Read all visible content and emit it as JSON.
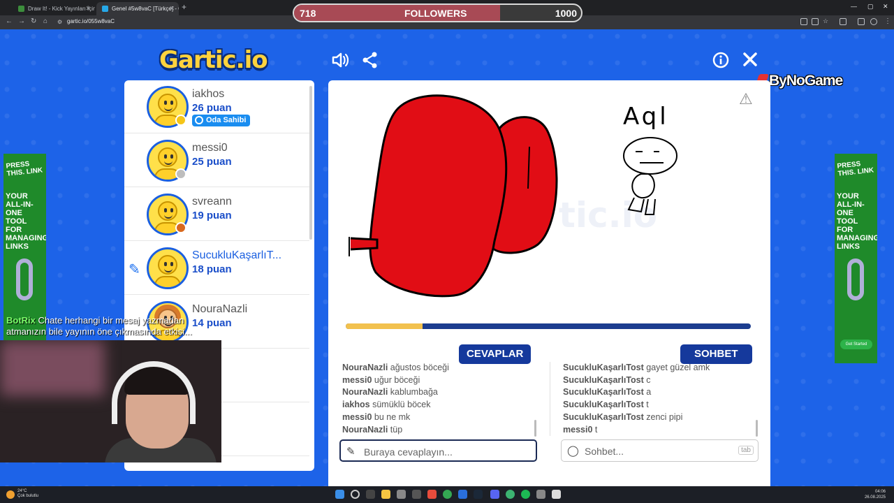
{
  "browser": {
    "tabs": [
      {
        "title": "Draw It! - Kick Yayınları İçin Çizi...",
        "favicon": "#3c8d3c"
      },
      {
        "title": "Genel #5w8vaC [Türkçe] - Gartic.io",
        "favicon": "#26a8e8"
      }
    ],
    "url": "gartic.io/055w8vaC"
  },
  "followers": {
    "current": "718",
    "label": "FOLLOWERS",
    "goal": "1000",
    "progress": 0.718
  },
  "brand": {
    "logo": "Gartic.io",
    "sponsor": "ByNoGame"
  },
  "players": [
    {
      "name": "iakhos",
      "points": "26 puan",
      "badge": "Oda Sahibi",
      "status_color": "#f5c518",
      "drawing": false
    },
    {
      "name": "messi0",
      "points": "25 puan",
      "badge": "",
      "status_color": "#bdbdbd",
      "drawing": false
    },
    {
      "name": "svreann",
      "points": "19 puan",
      "badge": "",
      "status_color": "#d9691e",
      "drawing": false
    },
    {
      "name": "SucukluKaşarlıT...",
      "points": "18 puan",
      "badge": "",
      "status_color": "",
      "drawing": true
    },
    {
      "name": "NouraNazli",
      "points": "14 puan",
      "badge": "",
      "status_color": "",
      "drawing": false
    }
  ],
  "canvas": {
    "scribble_text": "Aql",
    "timer_progress": 0.19
  },
  "answers": {
    "title": "CEVAPLAR",
    "messages": [
      {
        "user": "NouraNazli",
        "text": "ağustos böceği"
      },
      {
        "user": "messi0",
        "text": "uğur böceği"
      },
      {
        "user": "NouraNazli",
        "text": "kablumbağa"
      },
      {
        "user": "iakhos",
        "text": "sümüklü böcek"
      },
      {
        "user": "messi0",
        "text": "bu ne mk"
      },
      {
        "user": "NouraNazli",
        "text": "tüp"
      }
    ],
    "placeholder": "Buraya cevaplayın..."
  },
  "chat": {
    "title": "SOHBET",
    "messages": [
      {
        "user": "SucukluKaşarlıTost",
        "text": "gayet güzel amk"
      },
      {
        "user": "SucukluKaşarlıTost",
        "text": "c"
      },
      {
        "user": "SucukluKaşarlıTost",
        "text": "a"
      },
      {
        "user": "SucukluKaşarlıTost",
        "text": "t"
      },
      {
        "user": "SucukluKaşarlıTost",
        "text": "zenci pipi"
      },
      {
        "user": "messi0",
        "text": "t"
      }
    ],
    "placeholder": "Sohbet...",
    "tab_hint": "tab"
  },
  "ad": {
    "headline": "PRESS THIS. LINK",
    "body": "YOUR ALL-IN-ONE TOOL FOR MANAGING LINKS",
    "cta": "Get Started"
  },
  "stream_chat": {
    "user": "BotRix",
    "text": "Chate herhangi bir mesaj yazmadan atmanızın bile yayının öne çıkmasında etkisi..."
  },
  "taskbar": {
    "temperature": "24°C",
    "weather": "Çok bulutlu",
    "time": "04:06",
    "date": "26.08.2025"
  }
}
